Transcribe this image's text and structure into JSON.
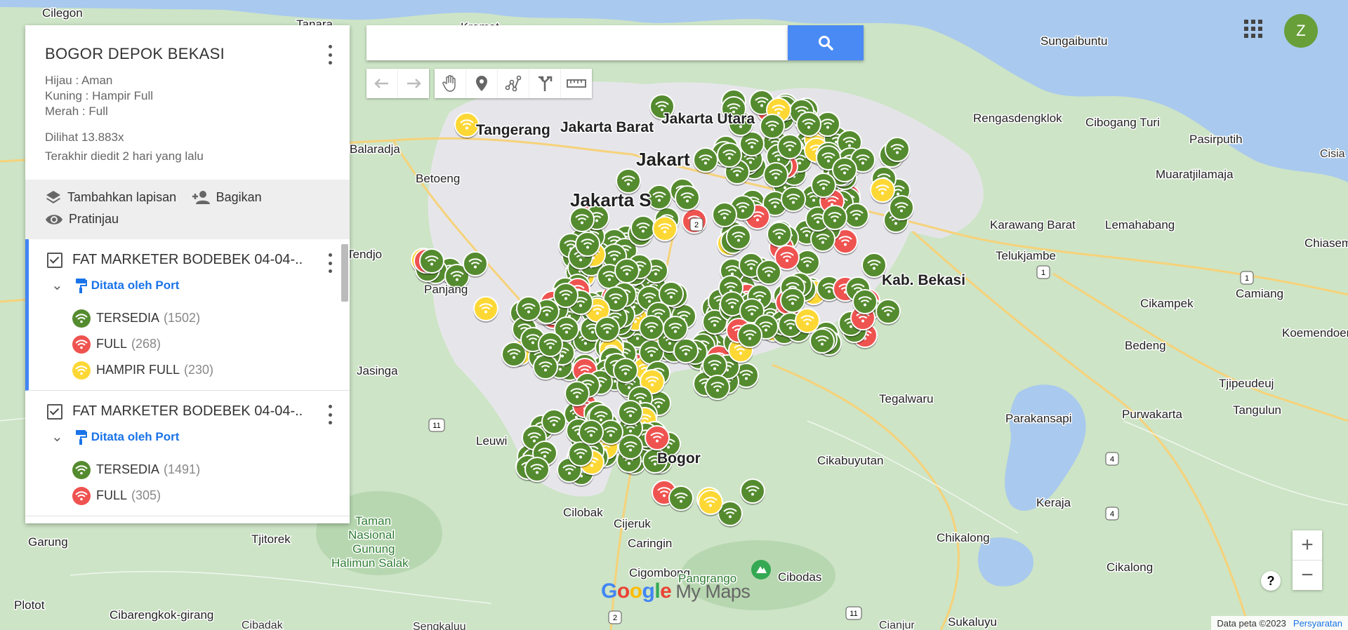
{
  "panel": {
    "title": "BOGOR DEPOK BEKASI",
    "description": [
      "Hijau : Aman",
      "Kuning : Hampir Full",
      "Merah : Full"
    ],
    "views": "Dilihat 13.883x",
    "edited": "Terakhir diedit 2 hari yang lalu",
    "actions": {
      "add_layer": "Tambahkan lapisan",
      "share": "Bagikan",
      "preview": "Pratinjau"
    },
    "layers": [
      {
        "name": "FAT MARKETER BODEBEK 04-04-...",
        "styled_by": "Ditata oleh Port",
        "legend": [
          {
            "label": "TERSEDIA",
            "count": "(1502)",
            "color": "#558b2f"
          },
          {
            "label": "FULL",
            "count": "(268)",
            "color": "#ef5350"
          },
          {
            "label": "HAMPIR FULL",
            "count": "(230)",
            "color": "#fdd835"
          }
        ]
      },
      {
        "name": "FAT MARKETER BODEBEK 04-04-...",
        "styled_by": "Ditata oleh Port",
        "legend": [
          {
            "label": "TERSEDIA",
            "count": "(1491)",
            "color": "#558b2f"
          },
          {
            "label": "FULL",
            "count": "(305)",
            "color": "#ef5350"
          }
        ]
      }
    ]
  },
  "search": {
    "placeholder": ""
  },
  "account": {
    "initial": "Z"
  },
  "zoom": {
    "in": "+",
    "out": "−"
  },
  "help": "?",
  "logo": {
    "google": "Google",
    "product": "My Maps"
  },
  "attribution": {
    "data": "Data peta ©2023",
    "terms": "Persyaratan"
  },
  "map_labels": [
    {
      "t": "Cilegon"
    },
    {
      "t": "Tanara"
    },
    {
      "t": "Kramat"
    },
    {
      "t": "Sungaibuntu"
    },
    {
      "t": "Tangerang"
    },
    {
      "t": "Jakarta Barat"
    },
    {
      "t": "Jakarta Utara"
    },
    {
      "t": "Jakart"
    },
    {
      "t": "Jakarta S"
    },
    {
      "t": "Balaradja"
    },
    {
      "t": "Betoeng"
    },
    {
      "t": "Rengasdengklok"
    },
    {
      "t": "Cibogang Turi"
    },
    {
      "t": "Pasirputih"
    },
    {
      "t": "Muaratjilamaja"
    },
    {
      "t": "Karawang Barat"
    },
    {
      "t": "Lemahabang"
    },
    {
      "t": "Telukjambe"
    },
    {
      "t": "Kab. Bekasi"
    },
    {
      "t": "Chiasem"
    },
    {
      "t": "Cikampek"
    },
    {
      "t": "Camiang"
    },
    {
      "t": "Koemendoen"
    },
    {
      "t": "Tendjo"
    },
    {
      "t": "Bedeng"
    },
    {
      "t": "Tjipeudeuj"
    },
    {
      "t": "Jasinga"
    },
    {
      "t": "Tegalwaru"
    },
    {
      "t": "Parakansapi"
    },
    {
      "t": "Purwakarta"
    },
    {
      "t": "Tangulun"
    },
    {
      "t": "Leuwi"
    },
    {
      "t": "Cikabuyutan"
    },
    {
      "t": "Keraja"
    },
    {
      "t": "Cilobak"
    },
    {
      "t": "Cijeruk"
    },
    {
      "t": "Caringin"
    },
    {
      "t": "Taman Nasional Gunung Halimun Salak"
    },
    {
      "t": "Garung"
    },
    {
      "t": "Tjitorek"
    },
    {
      "t": "Chikalong"
    },
    {
      "t": "Cikalong"
    },
    {
      "t": "Cigombong"
    },
    {
      "t": "Pangrango"
    },
    {
      "t": "Cibodas"
    },
    {
      "t": "Plotot"
    },
    {
      "t": "Cibarengkok-girang"
    },
    {
      "t": "Cibadak"
    },
    {
      "t": "Cianjur"
    },
    {
      "t": "Sukaluyu"
    },
    {
      "t": "Sengkaluu"
    },
    {
      "t": "Bogor"
    },
    {
      "t": "Panjang"
    },
    {
      "t": "Cisia"
    }
  ]
}
